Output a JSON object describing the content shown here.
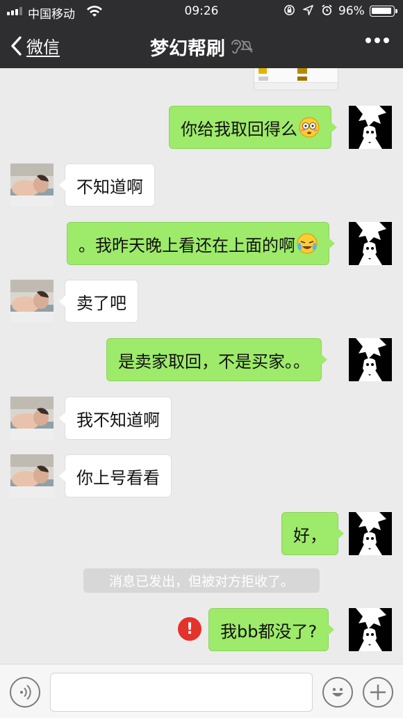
{
  "status_bar": {
    "carrier": "中国移动",
    "time": "09:26",
    "battery_percent": "96%",
    "battery_level": 0.96,
    "icons": [
      "signal-icon",
      "wifi-icon",
      "orientation-lock-icon",
      "location-icon",
      "alarm-icon",
      "battery-icon"
    ]
  },
  "nav": {
    "back_label": "微信",
    "title": "梦幻帮刷",
    "title_icons": [
      "earpiece-mode-icon",
      "mute-icon"
    ],
    "more_icon": "more-dots-icon"
  },
  "messages": [
    {
      "from": "me",
      "text": "你给我取回得么",
      "emoji": "flushed-face"
    },
    {
      "from": "them",
      "text": "不知道啊"
    },
    {
      "from": "me",
      "text": "。我昨天晚上看还在上面的啊",
      "emoji": "loudly-crying-face"
    },
    {
      "from": "them",
      "text": "卖了吧"
    },
    {
      "from": "me",
      "text": "是卖家取回，不是买家。。"
    },
    {
      "from": "them",
      "text": "我不知道啊"
    },
    {
      "from": "them",
      "text": "你上号看看"
    },
    {
      "from": "me",
      "text": "好，"
    },
    {
      "from": "me",
      "text": "我bb都没了?",
      "status": "failed"
    }
  ],
  "system_notice": "消息已发出，但被对方拒收了。",
  "fail_badge": "!",
  "input_bar": {
    "voice_icon": "voice-icon",
    "emoji_icon": "emoji-icon",
    "plus_icon": "plus-icon",
    "text_value": ""
  },
  "colors": {
    "header_bg": "#2e2e30",
    "chat_bg": "#ebebeb",
    "my_bubble": "#9eea6a",
    "their_bubble": "#ffffff",
    "error_red": "#e5322b"
  }
}
